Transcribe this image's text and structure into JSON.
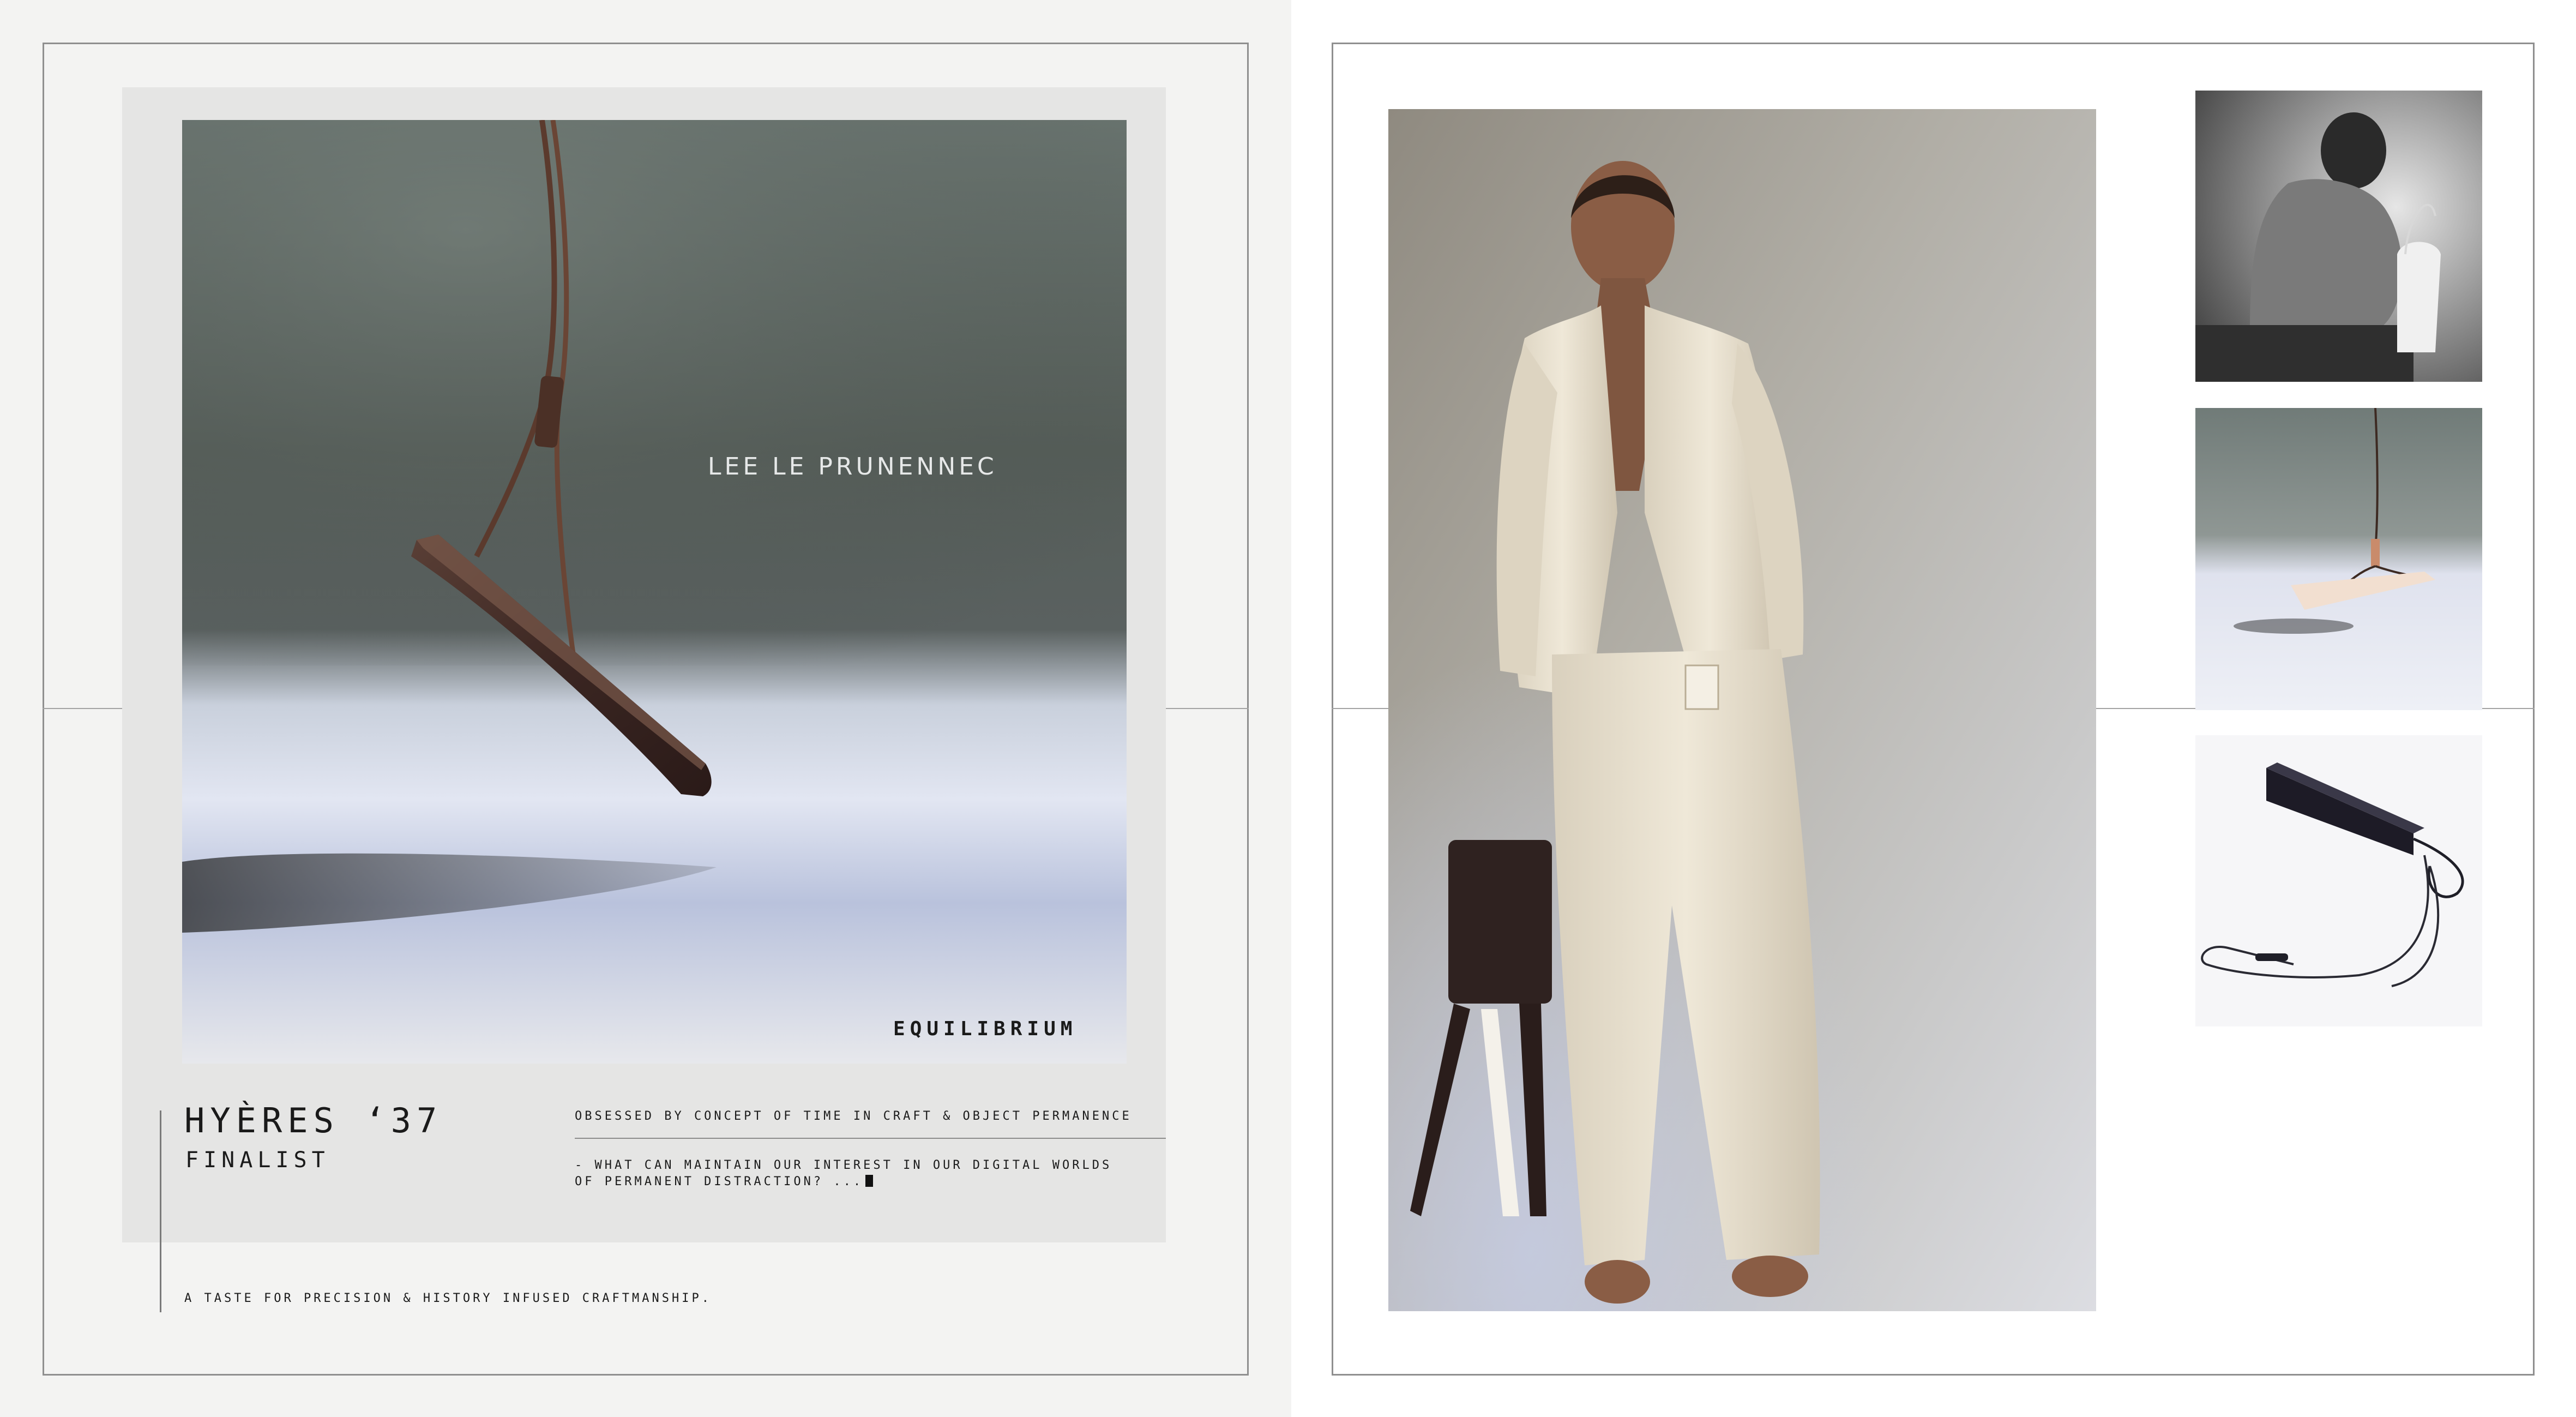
{
  "left_spread": {
    "artist_name": "LEE LE PRUNENNEC",
    "collection_label": "EQUILIBRIUM",
    "event": {
      "title": "HYÈRES ‘37",
      "subtitle": "FINALIST"
    },
    "statement": {
      "headline": "OBSESSED BY CONCEPT OF TIME IN CRAFT & OBJECT PERMANENCE",
      "question_line1": "- WHAT CAN MAINTAIN OUR INTEREST IN OUR  DIGITAL WORLDS",
      "question_line2": "OF PERMANENT DISTRACTION?  ..."
    },
    "tagline": "A TASTE FOR PRECISION & HISTORY INFUSED CRAFTMANSHIP."
  },
  "right_spread": {
    "main_photo": "model in cream jacket and trousers holding dark leather bag",
    "thumbnails": [
      "black and white portrait of model holding white bag",
      "pale bag suspended by cord",
      "dark leather bag with black cord"
    ]
  },
  "colors": {
    "paper": "#f3f3f2",
    "card": "#e5e5e4",
    "ink": "#1a1a1a",
    "frame_line": "#8f8f8f"
  }
}
